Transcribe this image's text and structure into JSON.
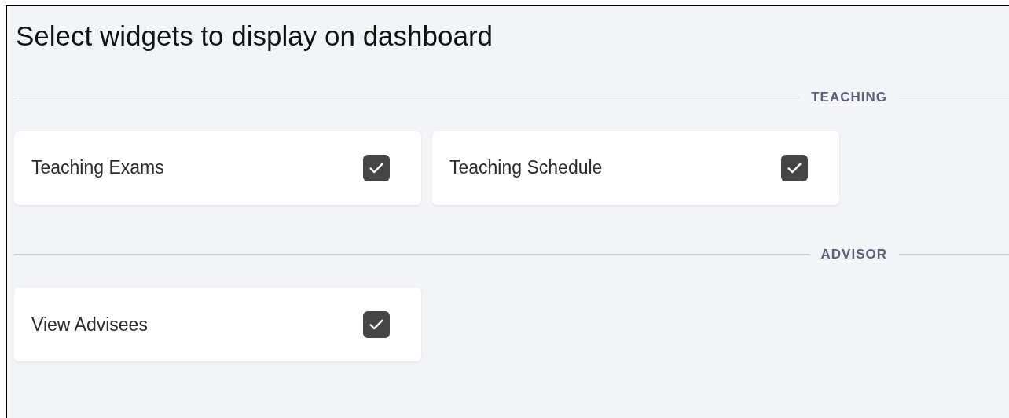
{
  "title": "Select widgets to display on dashboard",
  "sections": [
    {
      "label": "TEACHING",
      "widgets": [
        {
          "label": "Teaching Exams",
          "checked": true
        },
        {
          "label": "Teaching Schedule",
          "checked": true
        }
      ]
    },
    {
      "label": "ADVISOR",
      "widgets": [
        {
          "label": "View Advisees",
          "checked": true
        }
      ]
    }
  ]
}
